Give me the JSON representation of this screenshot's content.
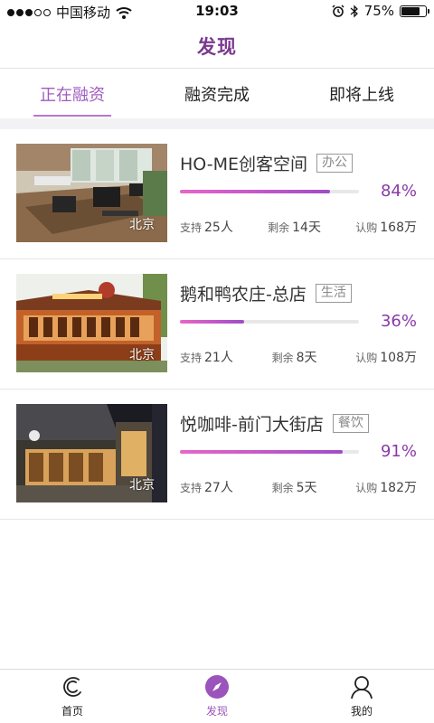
{
  "status_bar": {
    "carrier": "中国移动",
    "time": "19:03",
    "battery_percent_text": "75%",
    "battery_level": 0.75,
    "signal_filled": 3,
    "signal_total": 5
  },
  "header": {
    "title": "发现"
  },
  "tabs": [
    {
      "label": "正在融资",
      "active": true
    },
    {
      "label": "融资完成",
      "active": false
    },
    {
      "label": "即将上线",
      "active": false
    }
  ],
  "projects": [
    {
      "name": "HO-ME创客空间",
      "tag": "办公",
      "city": "北京",
      "progress": 0.84,
      "percent_text": "84%",
      "support_label": "支持",
      "support_value": "25人",
      "remain_label": "剩余",
      "remain_value": "14天",
      "subscribe_label": "认购",
      "subscribe_value": "168万"
    },
    {
      "name": "鹅和鸭农庄-总店",
      "tag": "生活",
      "city": "北京",
      "progress": 0.36,
      "percent_text": "36%",
      "support_label": "支持",
      "support_value": "21人",
      "remain_label": "剩余",
      "remain_value": "8天",
      "subscribe_label": "认购",
      "subscribe_value": "108万"
    },
    {
      "name": "悦咖啡-前门大街店",
      "tag": "餐饮",
      "city": "北京",
      "progress": 0.91,
      "percent_text": "91%",
      "support_label": "支持",
      "support_value": "27人",
      "remain_label": "剩余",
      "remain_value": "5天",
      "subscribe_label": "认购",
      "subscribe_value": "182万"
    }
  ],
  "bottom_nav": [
    {
      "label": "首页",
      "icon": "home-c-icon",
      "active": false
    },
    {
      "label": "发现",
      "icon": "compass-icon",
      "active": true
    },
    {
      "label": "我的",
      "icon": "user-icon",
      "active": false
    }
  ],
  "colors": {
    "accent": "#7b3a8f",
    "tab_active": "#a05cc0",
    "progress_start": "#e866c8",
    "progress_end": "#a04cc8"
  }
}
